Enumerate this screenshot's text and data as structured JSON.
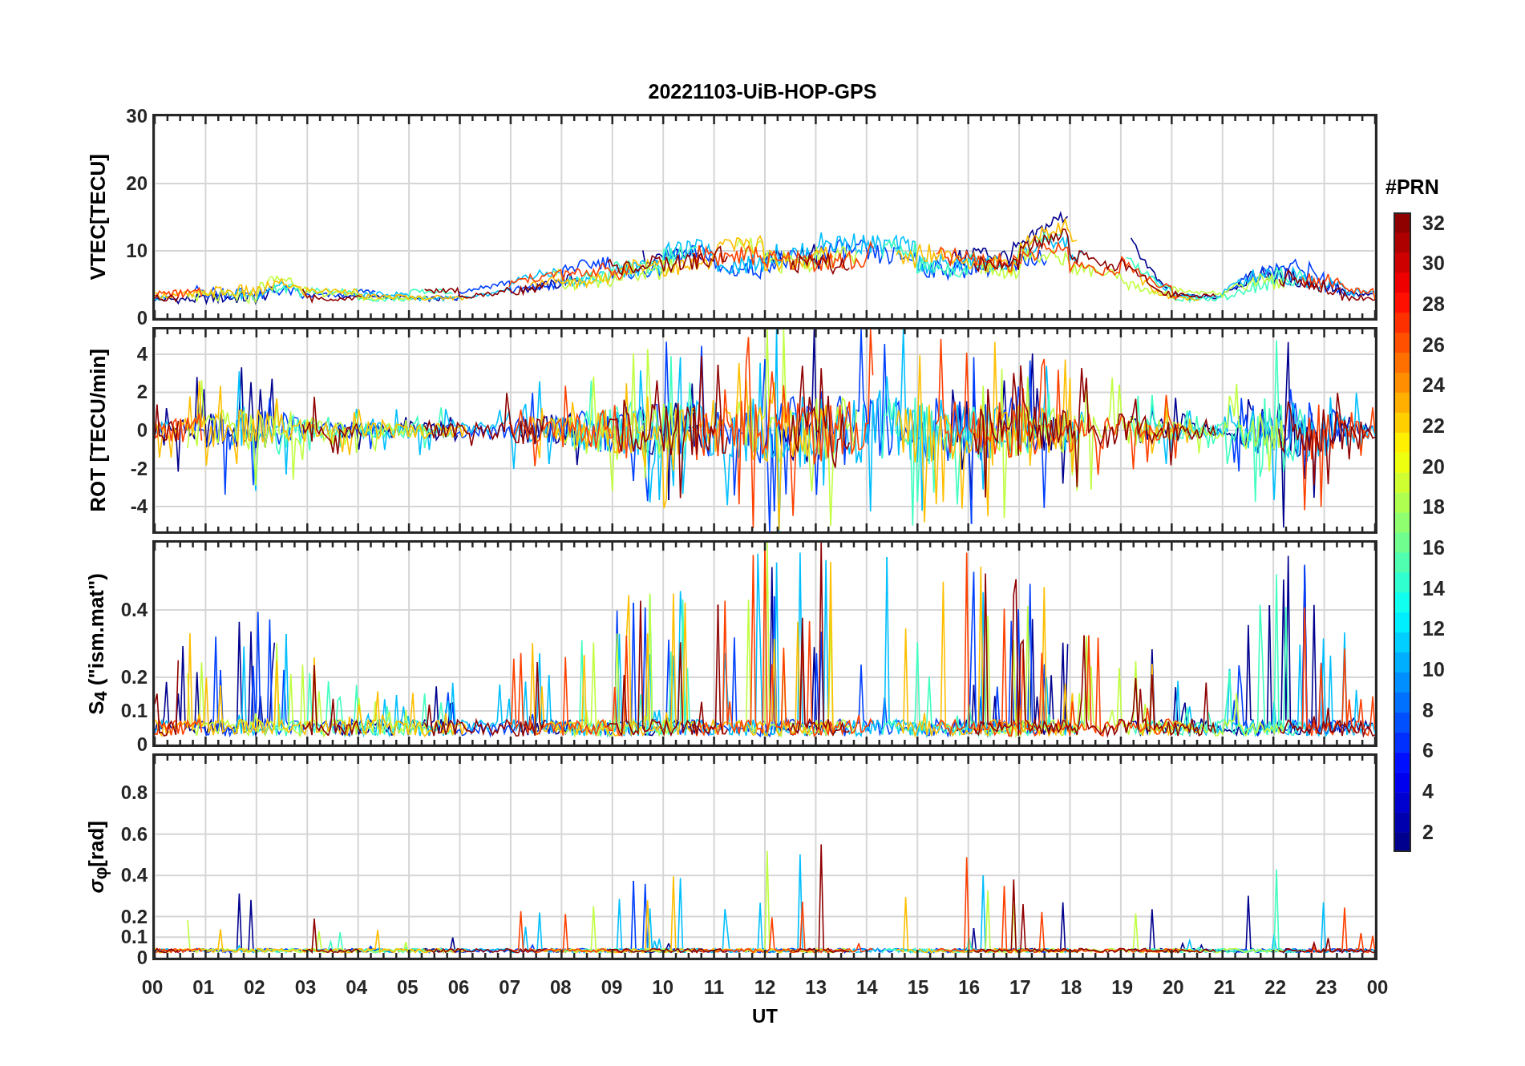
{
  "title": "20221103-UiB-HOP-GPS",
  "panels": [
    {
      "kind": "vtec",
      "ylabel": "VTEC[TECU]",
      "yticks": [
        "30",
        "20",
        "10",
        "0"
      ]
    },
    {
      "kind": "rot",
      "ylabel": "ROT [TECU/min]",
      "yticks": [
        "4",
        "2",
        "0",
        "-2",
        "-4"
      ]
    },
    {
      "kind": "s4",
      "ylabel": "S$_{4}$ (\"ism.mat\")",
      "yticks": [
        "0.4",
        "0.2",
        "0.1",
        "0"
      ]
    },
    {
      "kind": "sigma",
      "ylabel": "*σ*$_{φ}$[rad]",
      "yticks": [
        "0.8",
        "0.6",
        "0.4",
        "0.2",
        "0.1",
        "0"
      ]
    }
  ],
  "x_axis": {
    "label": "UT",
    "ticks": [
      "00",
      "01",
      "02",
      "03",
      "04",
      "05",
      "06",
      "07",
      "08",
      "09",
      "10",
      "11",
      "12",
      "13",
      "14",
      "15",
      "16",
      "17",
      "18",
      "19",
      "20",
      "21",
      "22",
      "23",
      "00"
    ]
  },
  "colorbar": {
    "label": "#PRN",
    "ticks": [
      "32",
      "30",
      "28",
      "26",
      "24",
      "22",
      "20",
      "18",
      "16",
      "14",
      "12",
      "10",
      "8",
      "6",
      "4",
      "2"
    ]
  }
}
